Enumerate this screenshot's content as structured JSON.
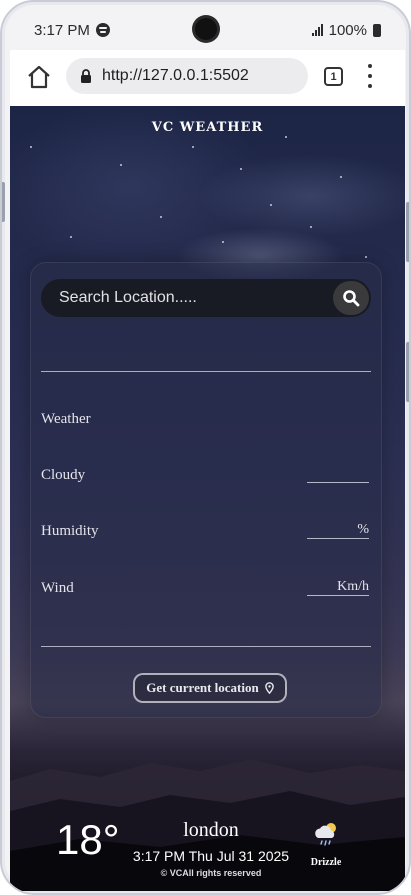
{
  "status_bar": {
    "time": "3:17 PM",
    "battery": "100%"
  },
  "browser": {
    "url": "http://127.0.0.1:5502",
    "tab_count": "1"
  },
  "app": {
    "title": "VC WEATHER"
  },
  "search": {
    "placeholder": "Search Location....."
  },
  "stats": {
    "weather_label": "Weather",
    "cloudy_label": "Cloudy",
    "humidity_label": "Humidity",
    "wind_label": "Wind",
    "humidity_unit": "%",
    "wind_unit": "Km/h"
  },
  "location_button": {
    "label": "Get current location"
  },
  "footer": {
    "temperature": "18°",
    "city": "london",
    "datetime": "3:17 PM Thu Jul 31 2025",
    "copyright": "© VCAll rights reserved",
    "condition": "Drizzle",
    "condition_icon": "drizzle-icon"
  },
  "colors": {
    "accent_sun": "#f2c94c",
    "card_bg": "#282c48"
  }
}
